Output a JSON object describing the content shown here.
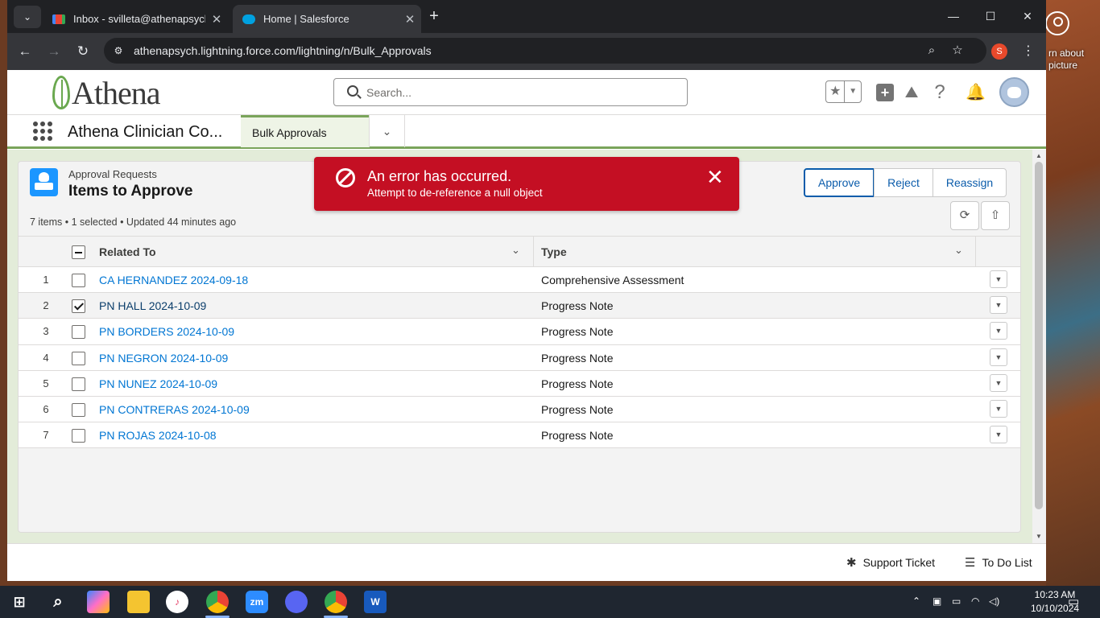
{
  "desktop": {
    "wallpaper_text": "rn about\npicture"
  },
  "browser": {
    "tabs": [
      {
        "title": "Inbox - svilleta@athenapsych.c",
        "favicon": "gmail-icon",
        "active": false
      },
      {
        "title": "Home | Salesforce",
        "favicon": "salesforce-cloud-icon",
        "active": true
      }
    ],
    "new_tab": "+",
    "url": "athenapsych.lightning.force.com/lightning/n/Bulk_Approvals",
    "profile_initial": "S"
  },
  "sf": {
    "logo_text": "Athena",
    "search_placeholder": "Search...",
    "app_name": "Athena Clinician Co...",
    "nav_tab": "Bulk Approvals"
  },
  "card": {
    "eyebrow": "Approval Requests",
    "title": "Items to Approve",
    "meta": "7 items • 1 selected • Updated 44 minutes ago",
    "buttons": {
      "approve": "Approve",
      "reject": "Reject",
      "reassign": "Reassign"
    },
    "columns": {
      "related_to": "Related To",
      "type": "Type"
    },
    "rows": [
      {
        "num": "1",
        "related": "CA HERNANDEZ 2024-09-18",
        "type": "Comprehensive Assessment",
        "checked": false
      },
      {
        "num": "2",
        "related": "PN HALL 2024-10-09",
        "type": "Progress Note",
        "checked": true
      },
      {
        "num": "3",
        "related": "PN BORDERS 2024-10-09",
        "type": "Progress Note",
        "checked": false
      },
      {
        "num": "4",
        "related": "PN NEGRON 2024-10-09",
        "type": "Progress Note",
        "checked": false
      },
      {
        "num": "5",
        "related": "PN NUNEZ 2024-10-09",
        "type": "Progress Note",
        "checked": false
      },
      {
        "num": "6",
        "related": "PN CONTRERAS 2024-10-09",
        "type": "Progress Note",
        "checked": false
      },
      {
        "num": "7",
        "related": "PN ROJAS 2024-10-08",
        "type": "Progress Note",
        "checked": false
      }
    ]
  },
  "toast": {
    "title": "An error has occurred.",
    "message": "Attempt to de-reference a null object",
    "color": "#c40f23"
  },
  "utility": {
    "support": "Support Ticket",
    "todo": "To Do List"
  },
  "taskbar": {
    "time": "10:23 AM",
    "date": "10/10/2024",
    "zoom_label": "zm"
  },
  "colors": {
    "brand_green": "#7aa45a",
    "link_blue": "#0176d3",
    "error_red": "#c40f23"
  }
}
